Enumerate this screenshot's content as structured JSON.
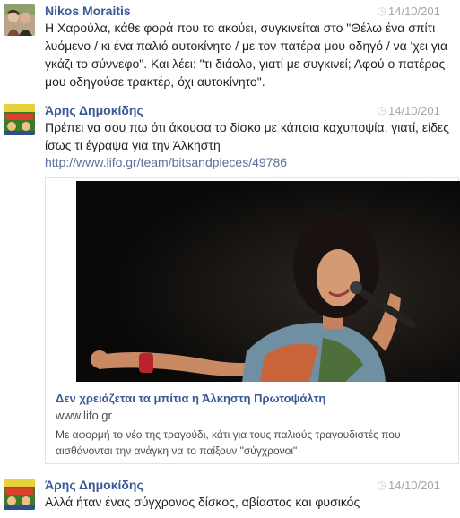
{
  "comments": [
    {
      "author": "Nikos Moraitis",
      "timestamp": "14/10/201",
      "text": "Η Χαρούλα, κάθε φορά που το ακούει, συγκινείται στο \"Θέλω ένα σπίτι λυόμενο / κι ένα παλιό αυτοκίνητο / με τον πατέρα μου οδηγό / να 'χει για γκάζι το σύννεφο\". Και λέει: \"τι διάολο, γιατί με συγκινεί; Αφού ο πατέρας μου οδηγούσε τρακτέρ, όχι αυτοκίνητο\"."
    },
    {
      "author": "Άρης Δημοκίδης",
      "timestamp": "14/10/201",
      "text": "Πρέπει να σου πω ότι άκουσα το δίσκο με κάποια καχυποψία, γιατί, είδες ίσως τι έγραψα για την Άλκηστη",
      "link": "http://www.lifo.gr/team/bitsandpieces/49786",
      "share": {
        "title": "Δεν χρειάζεται τα μπίτια η Άλκηστη Πρωτοψάλτη",
        "domain": "www.lifo.gr",
        "description": "Με αφορμή το νέο της τραγούδι, κάτι για τους παλιούς τραγουδιστές που αισθάνονται την ανάγκη να το παίξουν \"σύγχρονοι\""
      }
    },
    {
      "author": "Άρης Δημοκίδης",
      "timestamp": "14/10/201",
      "text": "Αλλά ήταν ένας σύγχρονος δίσκος, αβίαστος και φυσικός"
    }
  ],
  "colors": {
    "author_link": "#3b5998",
    "timestamp": "#a6a6a6",
    "link": "#5a6f9a"
  }
}
